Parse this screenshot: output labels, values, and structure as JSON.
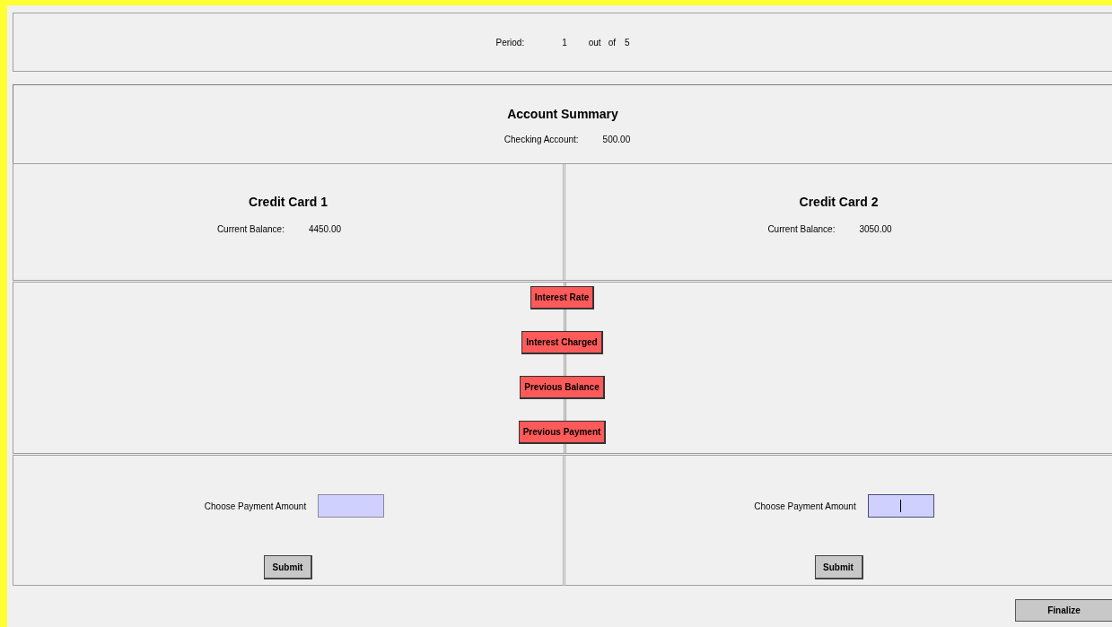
{
  "period": {
    "label": "Period:",
    "current": "1",
    "out_word": "out",
    "of_word": "of",
    "total": "5"
  },
  "summary": {
    "title": "Account Summary",
    "label": "Checking Account:",
    "value": "500.00"
  },
  "cards": [
    {
      "title": "Credit Card 1",
      "label": "Current Balance:",
      "value": "4450.00"
    },
    {
      "title": "Credit Card 2",
      "label": "Current Balance:",
      "value": "3050.00"
    }
  ],
  "info_buttons": [
    "Interest Rate",
    "Interest Charged",
    "Previous Balance",
    "Previous Payment"
  ],
  "payments": [
    {
      "label": "Choose Payment Amount",
      "focused": false,
      "button": "Submit"
    },
    {
      "label": "Choose Payment Amount",
      "focused": true,
      "button": "Submit"
    }
  ],
  "finalize_button": "Finalize"
}
